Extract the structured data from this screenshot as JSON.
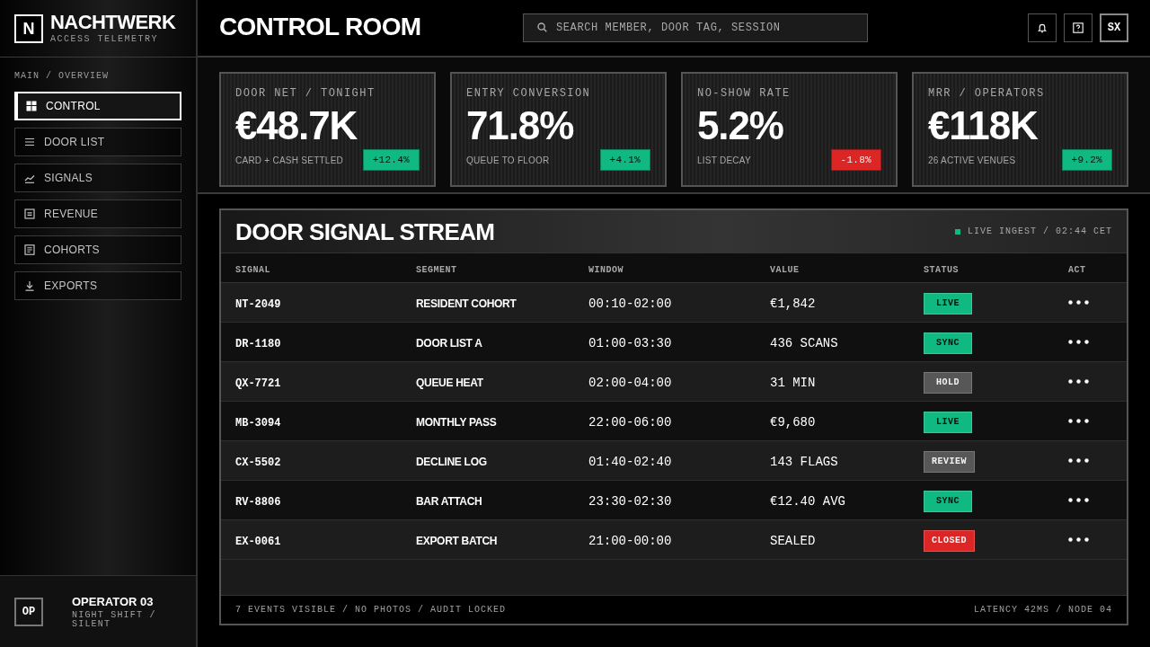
{
  "sidebar": {
    "brand": {
      "mark": "N",
      "name": "NACHTWERK",
      "tagline": "ACCESS TELEMETRY"
    },
    "breadcrumb": "MAIN / OVERVIEW",
    "items": [
      {
        "label": "CONTROL",
        "selected": true
      },
      {
        "label": "DOOR LIST",
        "selected": false
      },
      {
        "label": "SIGNALS",
        "selected": false
      },
      {
        "label": "REVENUE",
        "selected": false
      },
      {
        "label": "COHORTS",
        "selected": false
      },
      {
        "label": "EXPORTS",
        "selected": false
      }
    ],
    "user": {
      "initials": "OP",
      "name": "OPERATOR 03",
      "status": "NIGHT SHIFT / SILENT"
    }
  },
  "header": {
    "title": "CONTROL ROOM",
    "search": {
      "placeholder": "SEARCH MEMBER, DOOR TAG, SESSION"
    },
    "avatar": "SX"
  },
  "kpis": [
    {
      "label": "DOOR NET / TONIGHT",
      "value": "€48.7K",
      "note": "CARD + CASH SETTLED",
      "delta": {
        "text": "+12.4%",
        "color": "#10b981"
      }
    },
    {
      "label": "ENTRY CONVERSION",
      "value": "71.8%",
      "note": "QUEUE TO FLOOR",
      "delta": {
        "text": "+4.1%",
        "color": "#10b981"
      }
    },
    {
      "label": "NO-SHOW RATE",
      "value": "5.2%",
      "note": "LIST DECAY",
      "delta": {
        "text": "-1.8%",
        "color": "#dc2626"
      }
    },
    {
      "label": "MRR / OPERATORS",
      "value": "€118K",
      "note": "26 ACTIVE VENUES",
      "delta": {
        "text": "+9.2%",
        "color": "#10b981"
      }
    }
  ],
  "stream": {
    "title": "DOOR SIGNAL STREAM",
    "live": "LIVE INGEST / 02:44 CET",
    "columns": [
      "SIGNAL",
      "SEGMENT",
      "WINDOW",
      "VALUE",
      "STATUS",
      "ACT"
    ],
    "rows": [
      {
        "signal": "NT-2049",
        "segment": "RESIDENT COHORT",
        "window": "00:10-02:00",
        "value": "€1,842",
        "status": {
          "label": "LIVE",
          "color": "#10b981"
        }
      },
      {
        "signal": "DR-1180",
        "segment": "DOOR LIST A",
        "window": "01:00-03:30",
        "value": "436 SCANS",
        "status": {
          "label": "SYNC",
          "color": "#10b981"
        }
      },
      {
        "signal": "QX-7721",
        "segment": "QUEUE HEAT",
        "window": "02:00-04:00",
        "value": "31 MIN",
        "status": {
          "label": "HOLD",
          "color": "#575757"
        }
      },
      {
        "signal": "MB-3094",
        "segment": "MONTHLY PASS",
        "window": "22:00-06:00",
        "value": "€9,680",
        "status": {
          "label": "LIVE",
          "color": "#10b981"
        }
      },
      {
        "signal": "CX-5502",
        "segment": "DECLINE LOG",
        "window": "01:40-02:40",
        "value": "143 FLAGS",
        "status": {
          "label": "REVIEW",
          "color": "#575757"
        }
      },
      {
        "signal": "RV-8806",
        "segment": "BAR ATTACH",
        "window": "23:30-02:30",
        "value": "€12.40 AVG",
        "status": {
          "label": "SYNC",
          "color": "#10b981"
        }
      },
      {
        "signal": "EX-0061",
        "segment": "EXPORT BATCH",
        "window": "21:00-00:00",
        "value": "SEALED",
        "status": {
          "label": "CLOSED",
          "color": "#dc2626"
        }
      }
    ],
    "footer_left": "7 EVENTS VISIBLE / NO PHOTOS / AUDIT LOCKED",
    "footer_right": "LATENCY 42MS / NODE 04"
  }
}
